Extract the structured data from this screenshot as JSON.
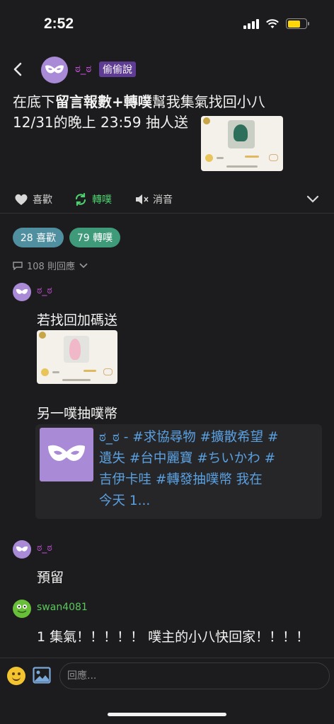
{
  "status_bar": {
    "time": "2:52",
    "battery_level": 0.7
  },
  "post": {
    "author": "ಠ_ಠ",
    "qualifier": "偷偷說",
    "line1": [
      "在底下",
      "留言報數",
      "+",
      "轉噗",
      "幫我集氣找回小八"
    ],
    "line2": "12/31的晚上 23:59 抽人送"
  },
  "actions": {
    "like": "喜歡",
    "replurk": "轉噗",
    "mute": "消音"
  },
  "stats": {
    "likes": "28 喜歡",
    "replurks": "79 轉噗",
    "responses": "108 則回應"
  },
  "responses": [
    {
      "name": "ಠ_ಠ",
      "text": "若找回加碼送"
    },
    {
      "text": "另一噗抽噗幣"
    },
    {
      "name": "ಠ_ಠ",
      "text": "預留"
    },
    {
      "name": "swan4081",
      "text": "1 集氣！！！！！ 噗主的小八快回家！！！！"
    }
  ],
  "link_preview": {
    "lines": [
      "ಠ_ಠ - #求協尋物 #擴散希望 #",
      "遺失 #台中麗寶 #ちいかわ #",
      "吉伊卡哇 #轉發抽噗幣 我在",
      "今天 1..."
    ]
  },
  "comment": {
    "placeholder": "回應..."
  },
  "colors": {
    "background": "#1c1c1e",
    "author": "#c44fd8",
    "replurk_green": "#4ccf6f",
    "link": "#5aa0e0",
    "likes_pill": "#4f8fa0",
    "replurks_pill": "#3f9a7a"
  }
}
